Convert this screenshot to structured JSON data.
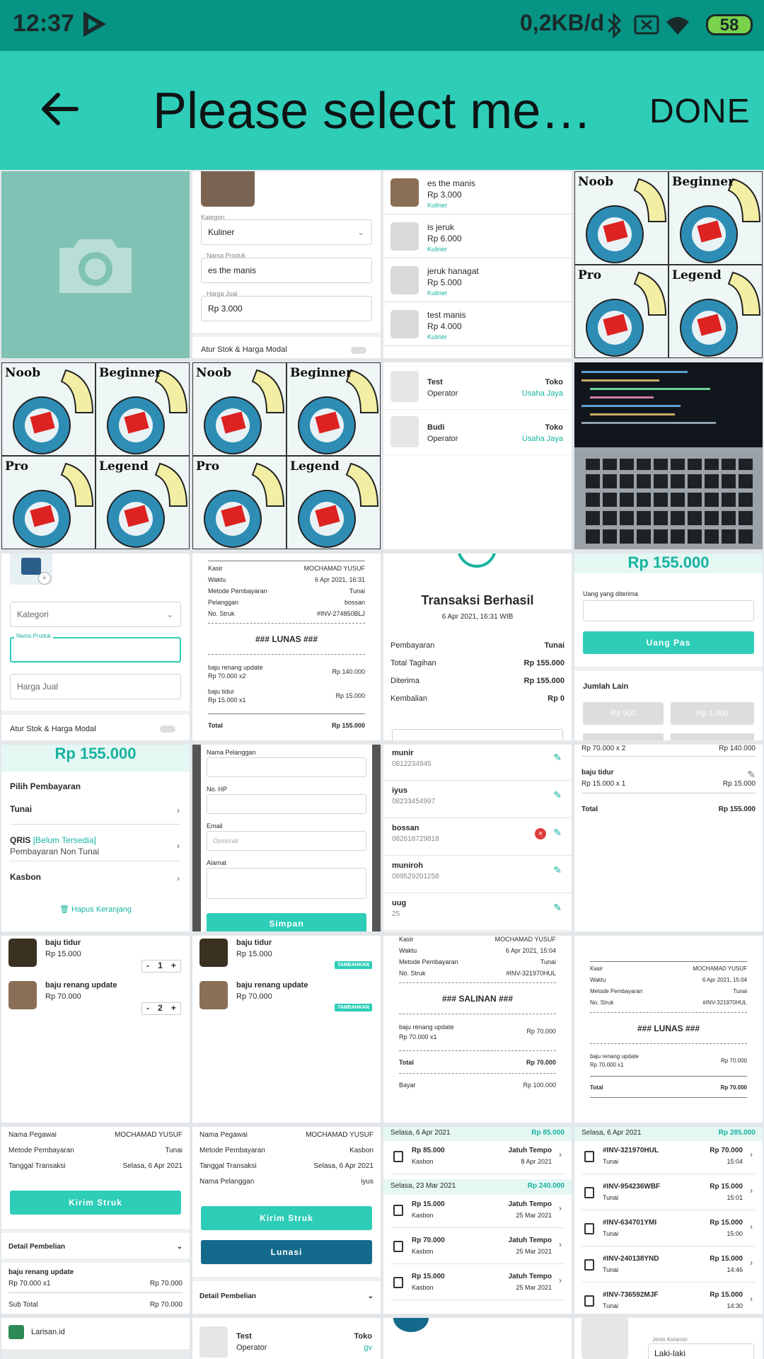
{
  "status_bar": {
    "time": "12:37",
    "data_rate": "0,2KB/d",
    "battery": "58"
  },
  "app_bar": {
    "title": "Please select me…",
    "done": "DONE"
  },
  "memes": {
    "noob": "Noob",
    "beginner": "Beginner",
    "pro": "Pro",
    "legend": "Legend"
  },
  "t01": {
    "kategori_label": "Kategori",
    "kategori_value": "Kuliner",
    "nama_label": "Nama Produk",
    "nama_value": "es the manis",
    "harga_label": "Harga Jual",
    "harga_value": "Rp 3.000",
    "stok_label": "Atur Stok & Harga Modal"
  },
  "t02": {
    "items": [
      {
        "name": "es the manis",
        "price": "Rp 3.000",
        "cat": "Kuliner"
      },
      {
        "name": "is jeruk",
        "price": "Rp 6.000",
        "cat": "Kuliner"
      },
      {
        "name": "jeruk hanagat",
        "price": "Rp 5.000",
        "cat": "Kuliner"
      },
      {
        "name": "test manis",
        "price": "Rp 4.000",
        "cat": "Kuliner"
      }
    ]
  },
  "t12": {
    "users": [
      {
        "name": "Test",
        "role": "Operator",
        "toko": "Toko",
        "store": "Usaha Jaya"
      },
      {
        "name": "Budi",
        "role": "Operator",
        "toko": "Toko",
        "store": "Usaha Jaya"
      }
    ]
  },
  "t20": {
    "kategori": "Kategori",
    "nama_label": "Nama Produk",
    "harga": "Harga Jual",
    "stok": "Atur Stok & Harga Modal"
  },
  "t21": {
    "rows": [
      [
        "Kasir",
        "MOCHAMAD YUSUF"
      ],
      [
        "Waktu",
        "6 Apr 2021, 16:31"
      ],
      [
        "Metode Pembayaran",
        "Tunai"
      ],
      [
        "Pelanggan",
        "bossan"
      ],
      [
        "No. Struk",
        "#INV-274850BLJ"
      ]
    ],
    "banner": "### LUNAS ###",
    "items": [
      {
        "name": "baju renang update",
        "qty": "Rp 70.000 x2",
        "total": "Rp 140.000"
      },
      {
        "name": "baju tidur",
        "qty": "Rp 15.000 x1",
        "total": "Rp 15.000"
      }
    ],
    "total_label": "Total",
    "total_value": "Rp 155.000"
  },
  "t22": {
    "title": "Transaksi Berhasil",
    "date": "6 Apr 2021, 16:31 WIB",
    "rows": [
      [
        "Pembayaran",
        "Tunai"
      ],
      [
        "Total Tagihan",
        "Rp 155.000"
      ],
      [
        "Diterima",
        "Rp 155.000"
      ],
      [
        "Kembalian",
        "Rp 0"
      ]
    ]
  },
  "t23": {
    "amount": "Rp 155.000",
    "uang_label": "Uang yang diterima",
    "pas": "Uang Pas",
    "lain": "Jumlah Lain",
    "opt1": "Rp 500",
    "opt2": "Rp 1.000"
  },
  "t30": {
    "amount": "Rp 155.000",
    "pilih": "Pilih Pembayaran",
    "tunai": "Tunai",
    "qris": "QRIS",
    "qris_note": "[Belum Tersedia]",
    "qris_sub": "Pembayaran Non Tunai",
    "kasbon": "Kasbon",
    "hapus": "Hapus Keranjang"
  },
  "t31": {
    "nama": "Nama Pelanggan",
    "hp": "No. HP",
    "email": "Email",
    "email_ph": "Opsional",
    "alamat": "Alamat",
    "simpan": "Simpan"
  },
  "t32": {
    "customers": [
      {
        "name": "munir",
        "phone": "0812234945"
      },
      {
        "name": "iyus",
        "phone": "08233454997"
      },
      {
        "name": "bossan",
        "phone": "082618729818"
      },
      {
        "name": "muniroh",
        "phone": "089529201258"
      },
      {
        "name": "uug",
        "phone": "25"
      }
    ]
  },
  "t33": {
    "top_left": "Rp 70.000 x 2",
    "top_right": "Rp 140.000",
    "item": "baju tidur",
    "item_qty": "Rp 15.000 x 1",
    "item_total": "Rp 15.000",
    "total_label": "Total",
    "total_value": "Rp 155.000"
  },
  "t40": {
    "items": [
      {
        "name": "baju tidur",
        "price": "Rp 15.000",
        "qty": "1"
      },
      {
        "name": "baju renang update",
        "price": "Rp 70.000",
        "qty": "2"
      }
    ]
  },
  "t41": {
    "items": [
      {
        "name": "baju tidur",
        "price": "Rp 15.000"
      },
      {
        "name": "baju renang update",
        "price": "Rp 70.000"
      }
    ],
    "tambah": "TAMBAHKAN"
  },
  "t42": {
    "rows": [
      [
        "Kasir",
        "MOCHAMAD YUSUF"
      ],
      [
        "Waktu",
        "6 Apr 2021, 15:04"
      ],
      [
        "Metode Pembayaran",
        "Tunai"
      ],
      [
        "No. Struk",
        "#INV-321970HUL"
      ]
    ],
    "banner": "### SALINAN ###",
    "item": "baju renang update",
    "item_qty": "Rp 70.000 x1",
    "item_total": "Rp 70.000",
    "total_label": "Total",
    "total_value": "Rp 70.000",
    "bayar_label": "Bayar",
    "bayar_value": "Rp 100.000"
  },
  "t43": {
    "rows": [
      [
        "Kasir",
        "MOCHAMAD YUSUF"
      ],
      [
        "Waktu",
        "6 Apr 2021, 15:04"
      ],
      [
        "Metode Pembayaran",
        "Tunai"
      ],
      [
        "No. Struk",
        "#INV-321970HUL"
      ]
    ],
    "banner": "### LUNAS ###",
    "item": "baju renang update",
    "item_qty": "Rp 70.000 x1",
    "item_total": "Rp 70.000",
    "total_label": "Total",
    "total_value": "Rp 70.000"
  },
  "t50": {
    "rows": [
      [
        "Nama Pegawai",
        "MOCHAMAD YUSUF"
      ],
      [
        "Metode Pembayaran",
        "Tunai"
      ],
      [
        "Tanggal Transaksi",
        "Selasa, 6 Apr 2021"
      ]
    ],
    "kirim": "Kirim Struk",
    "detail": "Detail Pembelian",
    "item": "baju renang update",
    "item_qty": "Rp 70.000 x1",
    "item_total": "Rp 70.000",
    "sub_label": "Sub Total",
    "sub_value": "Rp 70.000"
  },
  "t51": {
    "rows": [
      [
        "Nama Pegawai",
        "MOCHAMAD YUSUF"
      ],
      [
        "Metode Pembayaran",
        "Kasbon"
      ],
      [
        "Tanggal Transaksi",
        "Selasa, 6 Apr 2021"
      ],
      [
        "Nama Pelanggan",
        "iyus"
      ]
    ],
    "kirim": "Kirim Struk",
    "lunasi": "Lunasi",
    "detail": "Detail Pembelian"
  },
  "t52": {
    "h1_date": "Selasa, 6 Apr 2021",
    "h1_total": "Rp 85.000",
    "h2_date": "Selasa, 23 Mar 2021",
    "h2_total": "Rp 240.000",
    "first": {
      "amount": "Rp 85.000",
      "type": "Kasbon",
      "due": "Jatuh Tempo",
      "date": "8 Apr 2021"
    },
    "items": [
      {
        "amount": "Rp 15.000",
        "type": "Kasbon",
        "due": "Jatuh Tempo",
        "date": "25 Mar 2021"
      },
      {
        "amount": "Rp 70.000",
        "type": "Kasbon",
        "due": "Jatuh Tempo",
        "date": "25 Mar 2021"
      },
      {
        "amount": "Rp 15.000",
        "type": "Kasbon",
        "due": "Jatuh Tempo",
        "date": "25 Mar 2021"
      }
    ]
  },
  "t53": {
    "date": "Selasa, 6 Apr 2021",
    "total": "Rp 285.000",
    "items": [
      {
        "inv": "#INV-321970HUL",
        "type": "Tunai",
        "amount": "Rp 70.000",
        "time": "15:04"
      },
      {
        "inv": "#INV-954236WBF",
        "type": "Tunai",
        "amount": "Rp 15.000",
        "time": "15:01"
      },
      {
        "inv": "#INV-634701YMI",
        "type": "Tunai",
        "amount": "Rp 15.000",
        "time": "15:00"
      },
      {
        "inv": "#INV-240138YND",
        "type": "Tunai",
        "amount": "Rp 15.000",
        "time": "14:46"
      },
      {
        "inv": "#INV-736592MJF",
        "type": "Tunai",
        "amount": "Rp 15.000",
        "time": "14:30"
      }
    ]
  },
  "t60": {
    "app": "Larisan.id"
  },
  "t61": {
    "name": "Test",
    "role": "Operator",
    "toko": "Toko",
    "store": "gv"
  },
  "t63": {
    "label": "Jenis Kelamin",
    "value": "Laki-laki"
  },
  "colors": {
    "status": "#069484",
    "appbar": "#2ecdb8",
    "accent": "#17b3a0",
    "dark_button": "#146a8c"
  }
}
